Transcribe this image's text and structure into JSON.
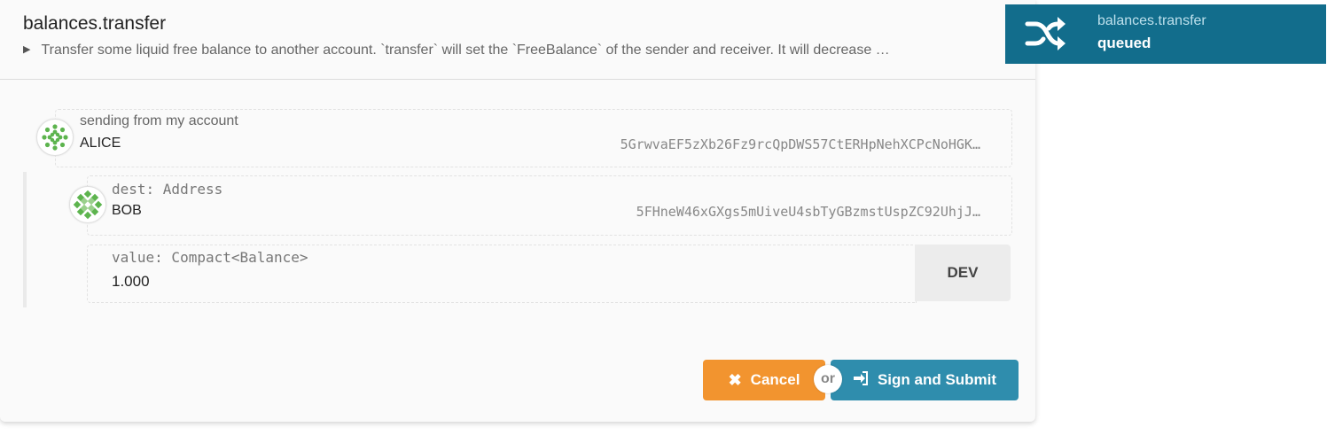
{
  "modal": {
    "title": "balances.transfer",
    "description": "Transfer some liquid free balance to another account. `transfer` will set the `FreeBalance` of the sender and receiver. It will decrease …"
  },
  "sender": {
    "label": "sending from my account",
    "name": "ALICE",
    "address": "5GrwvaEF5zXb26Fz9rcQpDWS57CtERHpNehXCPcNoHGK…"
  },
  "dest": {
    "label": "dest: Address",
    "name": "BOB",
    "address": "5FHneW46xGXgs5mUiveU4sbTyGBzmstUspZC92UhjJ…"
  },
  "value": {
    "label": "value: Compact<Balance>",
    "amount": "1.000",
    "unit": "DEV"
  },
  "actions": {
    "cancel_label": "Cancel",
    "or_label": "or",
    "submit_label": "Sign and Submit"
  },
  "toast": {
    "title": "balances.transfer",
    "status": "queued",
    "icon": "shuffle-icon"
  },
  "colors": {
    "cancel": "#f2942f",
    "submit": "#2f8dad",
    "toast": "#126d8c",
    "identicon_green": "#5db44e"
  }
}
